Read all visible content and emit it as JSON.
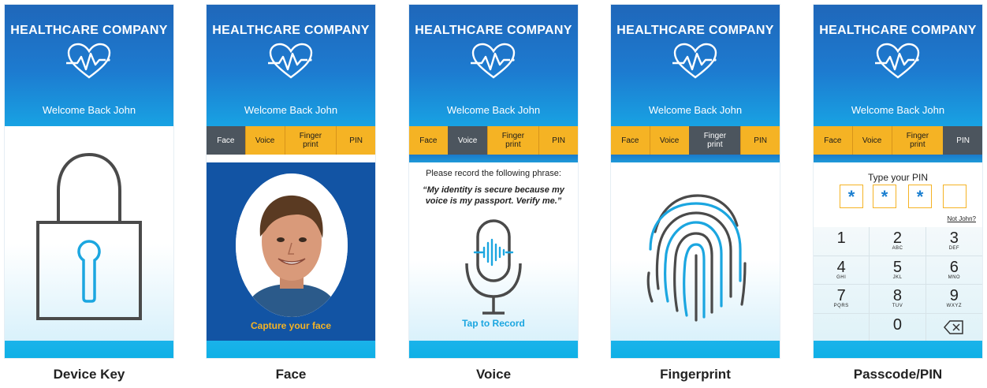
{
  "app": {
    "company": "HEALTHCARE COMPANY",
    "welcome": "Welcome Back John"
  },
  "tabs": [
    "Face",
    "Voice",
    "Finger print",
    "PIN"
  ],
  "screens": {
    "device_key": {
      "caption": "Device Key"
    },
    "face": {
      "caption": "Face",
      "active_tab": "Face",
      "prompt": "Capture your face"
    },
    "voice": {
      "caption": "Voice",
      "active_tab": "Voice",
      "prompt": "Please record the following phrase:",
      "phrase": "“My identity is secure because my voice is my passport. Verify me.”",
      "action": "Tap to Record"
    },
    "fingerprint": {
      "caption": "Fingerprint",
      "active_tab": "Finger print"
    },
    "pin": {
      "caption": "Passcode/PIN",
      "active_tab": "PIN",
      "title": "Type your PIN",
      "entered": [
        "*",
        "*",
        "*",
        ""
      ],
      "not_user_link": "Not John?",
      "keys": [
        {
          "num": "1",
          "letters": ""
        },
        {
          "num": "2",
          "letters": "ABC"
        },
        {
          "num": "3",
          "letters": "DEF"
        },
        {
          "num": "4",
          "letters": "GHI"
        },
        {
          "num": "5",
          "letters": "JKL"
        },
        {
          "num": "6",
          "letters": "MNO"
        },
        {
          "num": "7",
          "letters": "PQRS"
        },
        {
          "num": "8",
          "letters": "TUV"
        },
        {
          "num": "9",
          "letters": "WXYZ"
        },
        {
          "num": "",
          "letters": ""
        },
        {
          "num": "0",
          "letters": ""
        },
        {
          "num": "backspace-icon",
          "letters": ""
        }
      ]
    }
  },
  "colors": {
    "header_blue": "#1f67ba",
    "tab_yellow": "#f5b324",
    "tab_active": "#4c555e",
    "accent_cyan": "#1ba6e0",
    "icon_gray": "#4a4a4a"
  }
}
